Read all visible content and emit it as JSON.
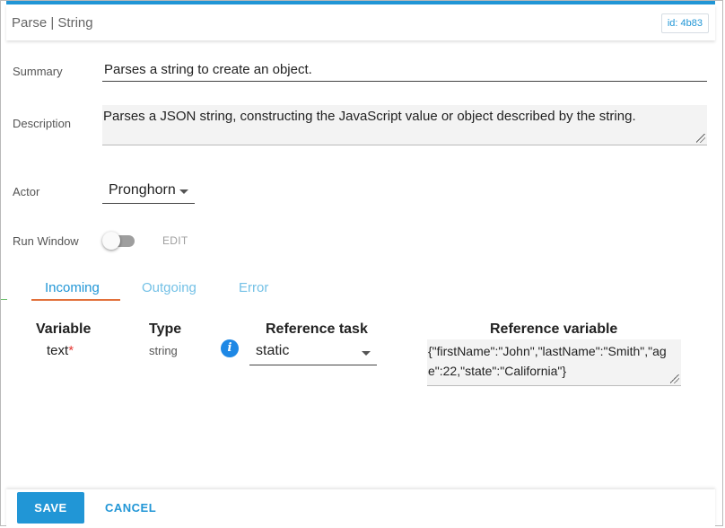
{
  "window": {
    "title": "Parse | String",
    "id_badge": "id: 4b83",
    "accent_color": "#2196d6"
  },
  "form": {
    "summary_label": "Summary",
    "summary_value": "Parses a string to create an object.",
    "description_label": "Description",
    "description_value": "Parses a JSON string, constructing the JavaScript value or object described by the string.",
    "actor_label": "Actor",
    "actor_value": "Pronghorn",
    "run_window_label": "Run Window",
    "run_window_enabled": false,
    "edit_label": "EDIT"
  },
  "tabs": [
    {
      "label": "Incoming",
      "active": true
    },
    {
      "label": "Outgoing",
      "active": false
    },
    {
      "label": "Error",
      "active": false
    }
  ],
  "table": {
    "headers": {
      "variable": "Variable",
      "type": "Type",
      "reference_task": "Reference task",
      "reference_variable": "Reference variable"
    },
    "rows": [
      {
        "variable": "text",
        "required_mark": "*",
        "type": "string",
        "info_icon": "info-icon",
        "reference_task": "static",
        "reference_variable": "{\"firstName\":\"John\",\"lastName\":\"Smith\",\"age\":22,\"state\":\"California\"}"
      }
    ]
  },
  "footer": {
    "save_label": "SAVE",
    "cancel_label": "CANCEL"
  }
}
